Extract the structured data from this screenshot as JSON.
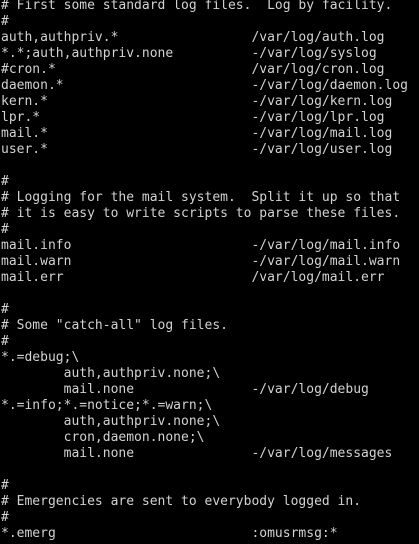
{
  "colors": {
    "background": "#000000",
    "text": "#d2d2d2"
  },
  "lines": [
    "# First some standard log files.  Log by facility.",
    "#",
    "auth,authpriv.*                 /var/log/auth.log",
    "*.*;auth,authpriv.none          -/var/log/syslog",
    "#cron.*                         /var/log/cron.log",
    "daemon.*                        -/var/log/daemon.log",
    "kern.*                          -/var/log/kern.log",
    "lpr.*                           -/var/log/lpr.log",
    "mail.*                          -/var/log/mail.log",
    "user.*                          -/var/log/user.log",
    "",
    "#",
    "# Logging for the mail system.  Split it up so that",
    "# it is easy to write scripts to parse these files.",
    "#",
    "mail.info                       -/var/log/mail.info",
    "mail.warn                       -/var/log/mail.warn",
    "mail.err                        /var/log/mail.err",
    "",
    "#",
    "# Some \"catch-all\" log files.",
    "#",
    "*.=debug;\\",
    "        auth,authpriv.none;\\",
    "        mail.none               -/var/log/debug",
    "*.=info;*.=notice;*.=warn;\\",
    "        auth,authpriv.none;\\",
    "        cron,daemon.none;\\",
    "        mail.none               -/var/log/messages",
    "",
    "#",
    "# Emergencies are sent to everybody logged in.",
    "#",
    "*.emerg                         :omusrmsg:*"
  ]
}
